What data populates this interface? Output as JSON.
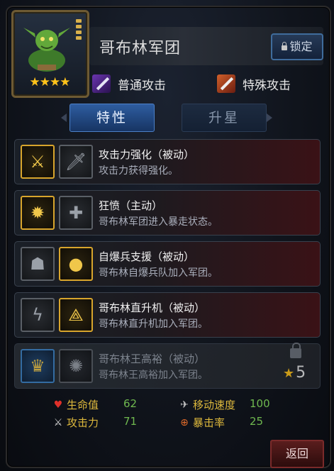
{
  "header": {
    "unit_name": "哥布林军团",
    "stars": "★★★★",
    "lock_label": "锁定"
  },
  "attacks": {
    "normal": "普通攻击",
    "special": "特殊攻击"
  },
  "tabs": [
    {
      "label": "特性",
      "active": true
    },
    {
      "label": "升星",
      "active": false
    }
  ],
  "skills": [
    {
      "title": "攻击力强化（被动）",
      "desc": "攻击力获得强化。",
      "icon1": "crossed-swords-icon",
      "icon2": "sword-icon"
    },
    {
      "title": "狂愤（主动）",
      "desc": "哥布林军团进入暴走状态。",
      "icon1": "rage-icon",
      "icon2": "cross-icon"
    },
    {
      "title": "自爆兵支援（被动）",
      "desc": "哥布林自爆兵队加入军团。",
      "icon1": "goblin-icon",
      "icon2": "bomb-icon"
    },
    {
      "title": "哥布林直升机（被动）",
      "desc": "哥布林直升机加入军团。",
      "icon1": "lightning-icon",
      "icon2": "helicopter-icon"
    },
    {
      "title": "哥布林王高裕（被动）",
      "desc": "哥布林王高裕加入军团。",
      "icon1": "crown-icon",
      "icon2": "burst-icon",
      "required_stars": "5"
    }
  ],
  "stats": {
    "hp_label": "生命值",
    "hp_value": "62",
    "move_label": "移动速度",
    "move_value": "100",
    "atk_label": "攻击力",
    "atk_value": "71",
    "crit_label": "暴击率",
    "crit_value": "25"
  },
  "footer": {
    "back_label": "返回"
  },
  "colors": {
    "gold": "#d8a52c",
    "stat_label": "#ddb83c",
    "stat_value": "#6fb84f",
    "tab_active": "#2e5da0"
  }
}
